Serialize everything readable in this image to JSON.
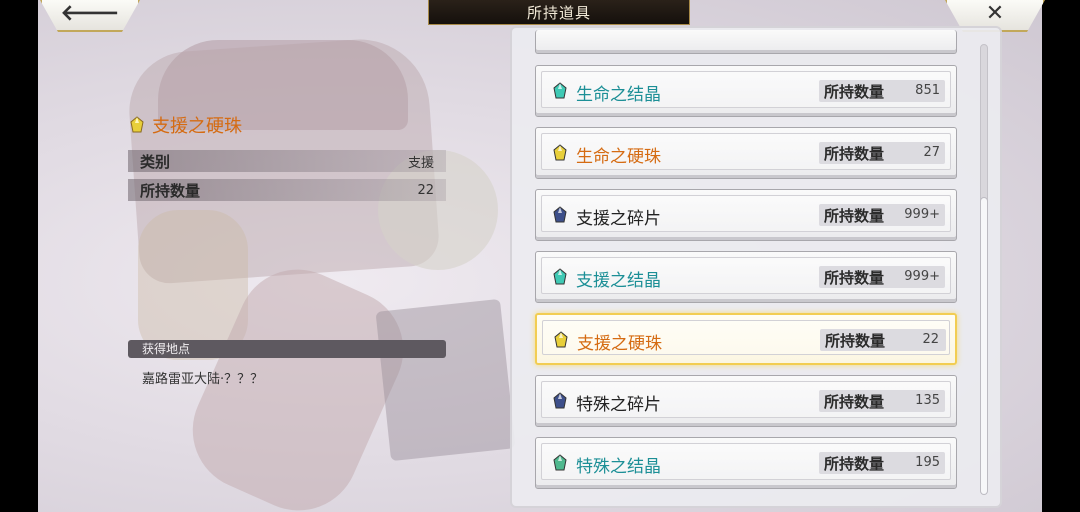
{
  "header": {
    "title": "所持道具",
    "back_icon": "arrow-left-icon",
    "back_glyph": "🡐",
    "close_icon": "close-icon",
    "close_glyph": "✕"
  },
  "detail": {
    "item_name": "支援之硬珠",
    "item_icon": "yellow-gem-icon",
    "item_color": "#d56b12",
    "category_label": "类别",
    "category_value": "支援",
    "owned_label": "所持数量",
    "owned_value": "22",
    "source_header": "获得地点",
    "source_text": "嘉路雷亚大陆·？？？"
  },
  "list": {
    "count_label": "所持数量",
    "items": [
      {
        "name": "生命之结晶",
        "count": "851",
        "gem_color": "#3fc9b4",
        "text_color": "#1c8f96",
        "icon": "teal-crystal-icon",
        "selected": false
      },
      {
        "name": "生命之硬珠",
        "count": "27",
        "gem_color": "#e8cf3a",
        "text_color": "#d56b12",
        "icon": "yellow-gem-icon",
        "selected": false
      },
      {
        "name": "支援之碎片",
        "count": "999+",
        "gem_color": "#3d4f8a",
        "text_color": "#222222",
        "icon": "dark-shard-icon",
        "selected": false
      },
      {
        "name": "支援之结晶",
        "count": "999+",
        "gem_color": "#3fc9b4",
        "text_color": "#1c8f96",
        "icon": "teal-crystal-icon",
        "selected": false
      },
      {
        "name": "支援之硬珠",
        "count": "22",
        "gem_color": "#e8cf3a",
        "text_color": "#d56b12",
        "icon": "yellow-gem-icon",
        "selected": true
      },
      {
        "name": "特殊之碎片",
        "count": "135",
        "gem_color": "#3d4f8a",
        "text_color": "#222222",
        "icon": "dark-shard-icon",
        "selected": false
      },
      {
        "name": "特殊之结晶",
        "count": "195",
        "gem_color": "#4fb88e",
        "text_color": "#1c8f96",
        "icon": "teal-crystal-icon",
        "selected": false
      }
    ]
  }
}
